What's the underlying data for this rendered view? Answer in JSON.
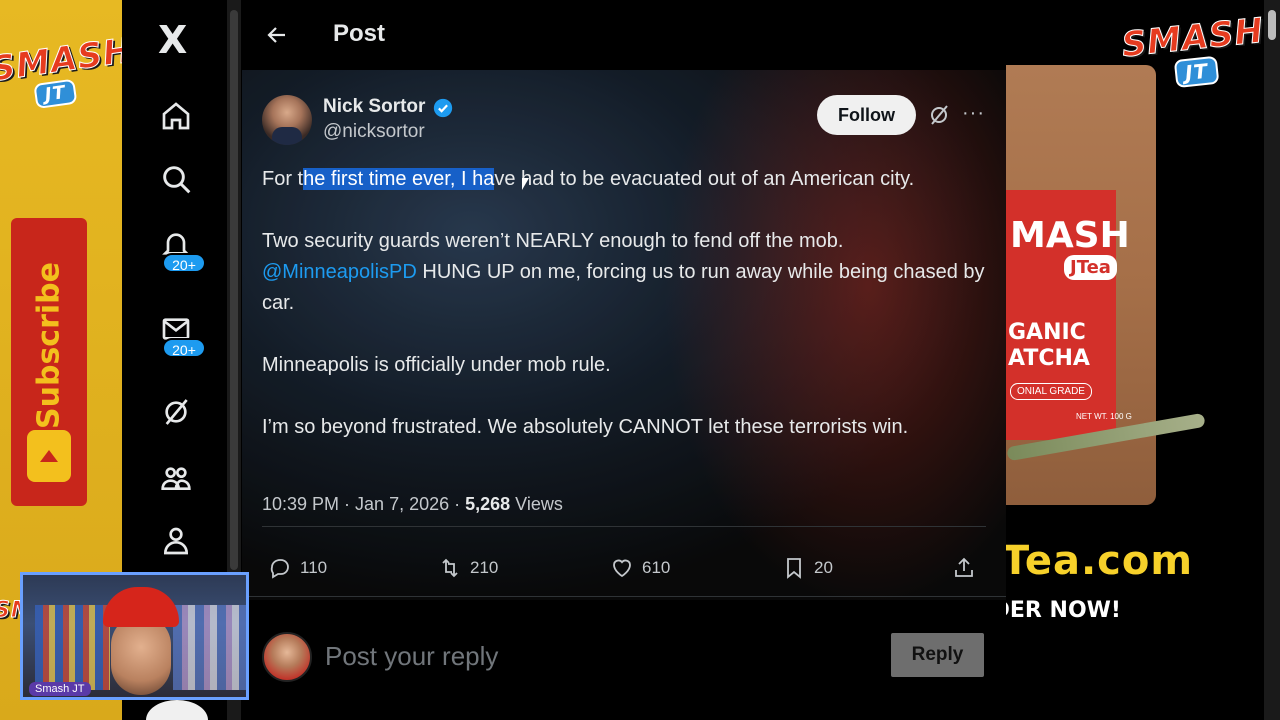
{
  "nav": {
    "x_logo": "X",
    "items": [
      {
        "icon": "home-icon"
      },
      {
        "icon": "search-icon"
      },
      {
        "icon": "bell-icon",
        "badge": "20+"
      },
      {
        "icon": "mail-icon",
        "badge": "20+"
      },
      {
        "icon": "grok-icon"
      },
      {
        "icon": "communities-icon"
      },
      {
        "icon": "profile-icon"
      }
    ]
  },
  "header": {
    "title": "Post"
  },
  "tweet": {
    "author_name": "Nick Sortor",
    "author_handle": "@nicksortor",
    "follow_label": "Follow",
    "more_label": "···",
    "line1_pre": "For t",
    "line1_highlight": "he first time ever, I ha",
    "line1_post": "ve had to be evacuated out of an American city.",
    "para2_text1": "Two security guards weren’t NEARLY enough to fend off the mob.",
    "para2_mention": "@MinneapolisPD",
    "para2_text2": " HUNG UP on me, forcing us to run away while being chased by car.",
    "para3": "Minneapolis is officially under mob rule.",
    "para4": "I’m so beyond frustrated. We absolutely CANNOT let these terrorists win.",
    "time": "10:39 PM · Jan 7, 2026 · ",
    "views_count": "5,268",
    "views_label": " Views",
    "replies": "110",
    "reposts": "210",
    "likes": "610",
    "bookmarks": "20"
  },
  "reply": {
    "placeholder": "Post your reply",
    "button_label": "Reply"
  },
  "overlay": {
    "left_logo_smash": "SMASH",
    "left_logo_jt": "JT",
    "subscribe": "Subscribe",
    "right_logo_smash": "SMASH",
    "right_logo_jt": "JT",
    "pouch_smash": "MASH",
    "pouch_jtea": "JTea",
    "pouch_organic": "GANIC\nATCHA",
    "pouch_grade": "ONIAL GRADE",
    "pouch_weight": "NET WT. 100 G",
    "ad_url": "JTea.com",
    "ad_order": "ORDER NOW!",
    "webcam_tag": "Smash JT"
  },
  "colors": {
    "accent": "#1d9bf0",
    "highlight": "#1760c8",
    "brand_red": "#d3302a",
    "brand_yellow": "#e7b923"
  }
}
